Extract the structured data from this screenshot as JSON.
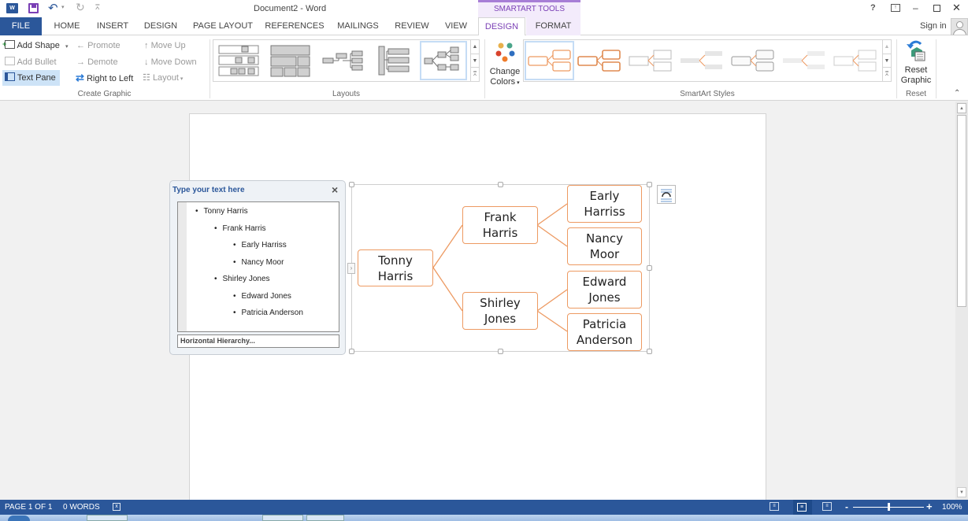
{
  "window": {
    "title": "Document2 - Word",
    "help": "?",
    "ribbon_display": "ribbon-display-options-icon",
    "minimize": "–",
    "restore": "restore-icon",
    "close": "✕",
    "sign_in": "Sign in"
  },
  "quick_access": {
    "save": "save-icon",
    "undo": "undo-icon",
    "redo": "redo-icon",
    "customize": "customize-icon"
  },
  "contextual_tab_group": "SMARTART TOOLS",
  "tabs": [
    {
      "label": "FILE"
    },
    {
      "label": "HOME"
    },
    {
      "label": "INSERT"
    },
    {
      "label": "DESIGN"
    },
    {
      "label": "PAGE LAYOUT"
    },
    {
      "label": "REFERENCES"
    },
    {
      "label": "MAILINGS"
    },
    {
      "label": "REVIEW"
    },
    {
      "label": "VIEW"
    },
    {
      "label": "DESIGN",
      "active": true
    },
    {
      "label": "FORMAT"
    }
  ],
  "ribbon": {
    "create_graphic": {
      "label": "Create Graphic",
      "add_shape": "Add Shape",
      "add_bullet": "Add Bullet",
      "text_pane": "Text Pane",
      "promote": "Promote",
      "demote": "Demote",
      "right_to_left": "Right to Left",
      "move_up": "Move Up",
      "move_down": "Move Down",
      "layout": "Layout"
    },
    "layouts": {
      "label": "Layouts",
      "selected_index": 4,
      "count": 5
    },
    "change_colors": {
      "line1": "Change",
      "line2": "Colors"
    },
    "smartart_styles": {
      "label": "SmartArt Styles",
      "selected_index": 0,
      "count": 7
    },
    "reset": {
      "line1": "Reset",
      "line2": "Graphic",
      "label": "Reset"
    }
  },
  "text_pane": {
    "title": "Type your text here",
    "close": "×",
    "items": [
      {
        "text": "Tonny Harris",
        "level": 1
      },
      {
        "text": "Frank Harris",
        "level": 2
      },
      {
        "text": "Early Harriss",
        "level": 3
      },
      {
        "text": "Nancy Moor",
        "level": 3
      },
      {
        "text": "Shirley Jones",
        "level": 2
      },
      {
        "text": "Edward Jones",
        "level": 3
      },
      {
        "text": "Patricia Anderson",
        "level": 3
      }
    ],
    "footer": "Horizontal Hierarchy..."
  },
  "smartart": {
    "accent_color": "#ed9a62",
    "nodes": {
      "root": "Tonny\nHarris",
      "child1": "Frank\nHarris",
      "child2": "Shirley\nJones",
      "leaf1": "Early\nHarriss",
      "leaf2": "Nancy\nMoor",
      "leaf3": "Edward\nJones",
      "leaf4": "Patricia\nAnderson"
    }
  },
  "status_bar": {
    "page": "PAGE 1 OF 1",
    "words": "0 WORDS",
    "zoom_minus": "-",
    "zoom_plus": "+",
    "zoom": "100%",
    "zoom_fraction": 0.5
  },
  "colors": {
    "file_tab": "#2b579a",
    "smartart_tools": "#a77ed6",
    "active_tab_text": "#7a3fb5",
    "status_bar": "#2b579a"
  }
}
